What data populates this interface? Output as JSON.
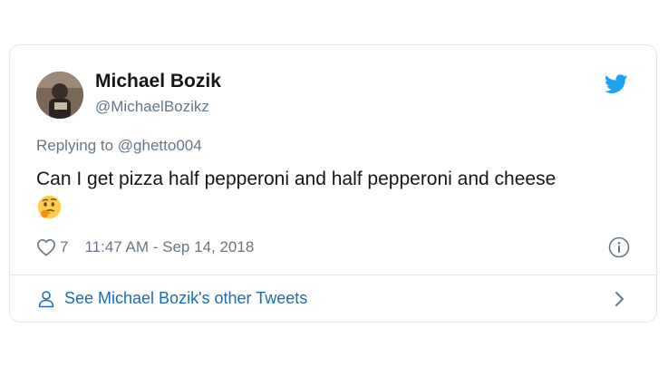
{
  "tweet": {
    "author_name": "Michael Bozik",
    "author_handle": "@MichaelBozikz",
    "replying_prefix": "Replying to",
    "replying_to": "@ghetto004",
    "text": "Can I get pizza half pepperoni and half pepperoni and cheese",
    "emoji": "thinking-face",
    "like_count": "7",
    "timestamp": "11:47 AM - Sep 14, 2018"
  },
  "footer": {
    "label": "See Michael Bozik's other Tweets"
  },
  "colors": {
    "twitter_blue": "#1da1f2",
    "link_blue": "#1b6cb5",
    "secondary_text": "#657786",
    "primary_text": "#14171a",
    "border": "#e1e8ed"
  },
  "icons": {
    "brand": "twitter-bird-icon",
    "like": "heart-icon",
    "info": "info-icon",
    "person": "person-icon",
    "chevron": "chevron-right-icon"
  }
}
